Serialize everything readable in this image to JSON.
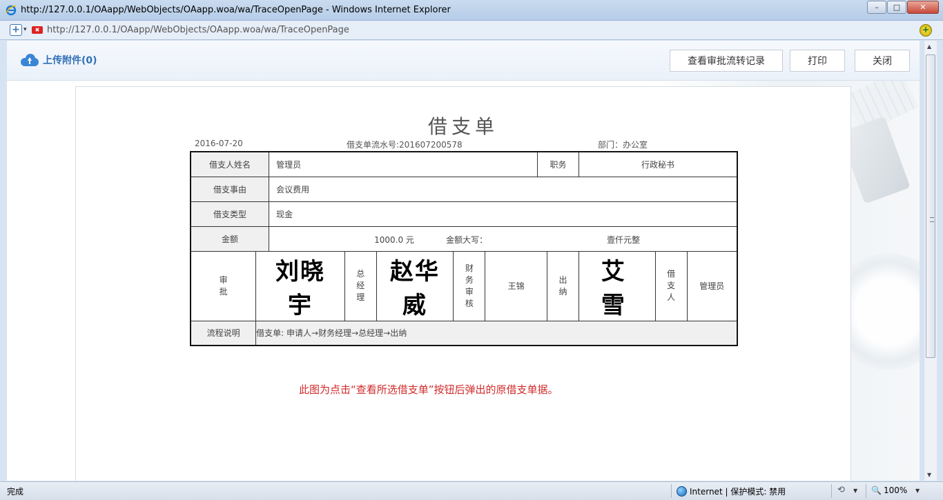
{
  "window": {
    "title": "http://127.0.0.1/OAapp/WebObjects/OAapp.woa/wa/TraceOpenPage - Windows Internet Explorer",
    "url": "http://127.0.0.1/OAapp/WebObjects/OAapp.woa/wa/TraceOpenPage",
    "minimize": "–",
    "maximize": "□",
    "close": "✕"
  },
  "toolbar": {
    "upload_label": "上传附件(0)",
    "view_history_label": "查看审批流转记录",
    "print_label": "打印",
    "close_label": "关闭"
  },
  "document": {
    "title": "借支单",
    "date": "2016-07-20",
    "serial": "借支单流水号:201607200578",
    "department": "部门：办公室",
    "rows": {
      "borrower_name_label": "借支人姓名",
      "borrower_name": "管理员",
      "position_label": "职务",
      "position": "行政秘书",
      "reason_label": "借支事由",
      "reason": "会议费用",
      "type_label": "借支类型",
      "type": "现金",
      "amount_label": "金额",
      "amount": "1000.0  元",
      "amount_upper_label": "金额大写：",
      "amount_upper": "壹仟元整"
    },
    "signatures": {
      "approval_label": "审\n批",
      "approval_sig": "刘晓宇",
      "gm_label": "总\n经\n理",
      "gm_sig": "赵华威",
      "finance_label": "财\n务\n审\n核",
      "finance_name": "王锦",
      "cashier_label": "出\n纳",
      "cashier_sig": "艾雪",
      "borrower_label": "借\n支\n人",
      "borrower_name": "管理员"
    },
    "flow_label": "流程说明",
    "flow_text": "借支单: 申请人→财务经理→总经理→出纳"
  },
  "note": "此图为点击“查看所选借支单”按钮后弹出的原借支单据。",
  "statusbar": {
    "status": "完成",
    "zone": "Internet | 保护模式: 禁用",
    "zoom": "100%"
  },
  "colors": {
    "accent": "#2f6fb7",
    "note": "#d12a2a"
  }
}
